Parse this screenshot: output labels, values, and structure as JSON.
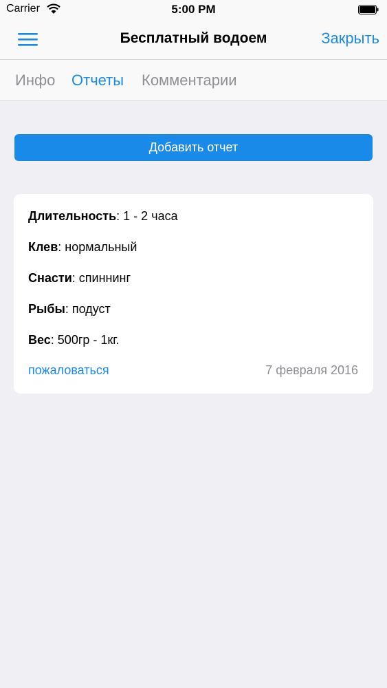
{
  "status_bar": {
    "carrier": "Carrier",
    "time": "5:00 PM"
  },
  "nav": {
    "title": "Бесплатный водоем",
    "close_label": "Закрыть",
    "menu_icon": "hamburger-menu-icon"
  },
  "tabs": [
    {
      "label": "Инфо",
      "active": false
    },
    {
      "label": "Отчеты",
      "active": true
    },
    {
      "label": "Комментарии",
      "active": false
    }
  ],
  "add_report_label": "Добавить отчет",
  "report": {
    "fields": [
      {
        "label": "Длительность",
        "value": ": 1 - 2 часа"
      },
      {
        "label": "Клев",
        "value": ": нормальный"
      },
      {
        "label": "Снасти",
        "value": ": спиннинг"
      },
      {
        "label": "Рыбы",
        "value": ": подуст"
      },
      {
        "label": "Вес",
        "value": ": 500гр - 1кг."
      }
    ],
    "complain_label": "пожаловаться",
    "date": "7 февраля 2016"
  },
  "colors": {
    "accent": "#1a8ae9",
    "background": "#f0eff4",
    "muted": "#8f8f94"
  }
}
